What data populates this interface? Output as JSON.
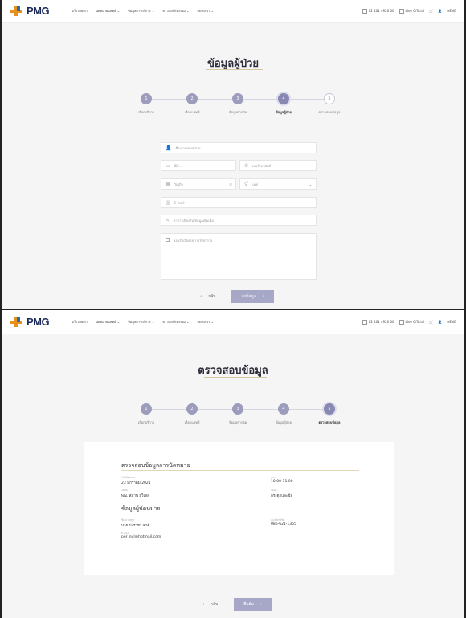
{
  "nav": {
    "logo": "PMG",
    "menu": [
      "เกี่ยวกับเรา",
      "นัดหมายแพทย์ ⌄",
      "ข้อมูลการบริการ ⌄",
      "ข่าวและกิจกรรม ⌄",
      "ติดต่อเรา ⌄"
    ],
    "phone": "02 401 4920 00",
    "line": "Line Official",
    "lang": "ENG"
  },
  "screen1": {
    "title": "ข้อมูลผู้ป่วย",
    "steps": [
      {
        "num": "1",
        "label": "เลือกบริการ",
        "state": "done"
      },
      {
        "num": "2",
        "label": "เลือกแพทย์",
        "state": "done"
      },
      {
        "num": "3",
        "label": "ข้อมูลการนัด",
        "state": "done"
      },
      {
        "num": "4",
        "label": "ข้อมูลผู้ป่วย",
        "state": "active"
      },
      {
        "num": "5",
        "label": "ตรวจสอบข้อมูล",
        "state": "pending"
      }
    ],
    "fields": {
      "name": "ชื่อ-นามสกุลผู้ป่วย",
      "id": "ID/...",
      "phone": "เบอร์โทรศัพท์",
      "birth": "วันเกิด",
      "gender": "เพศ",
      "email": "E-mail",
      "note_label": "อาการเบื้องต้น/ข้อมูลเพิ่มเติม",
      "consent": "ยอมรับเงื่อนไขการใช้บริการ"
    },
    "back": "กลับ",
    "next": "ส่งข้อมูล"
  },
  "screen2": {
    "title": "ตรวจสอบข้อมูล",
    "steps": [
      {
        "num": "1",
        "label": "เลือกบริการ",
        "state": "done"
      },
      {
        "num": "2",
        "label": "เลือกแพทย์",
        "state": "done"
      },
      {
        "num": "3",
        "label": "ข้อมูลการนัด",
        "state": "done"
      },
      {
        "num": "4",
        "label": "ข้อมูลผู้ป่วย",
        "state": "done"
      },
      {
        "num": "5",
        "label": "ตรวจสอบข้อมูล",
        "state": "active"
      }
    ],
    "section1": {
      "title": "ตรวจสอบข้อมูลการนัดหมาย",
      "date_label": "วันที่นัดหมาย",
      "date": "23 มกราคม 2021",
      "time_label": "เวลา",
      "time": "10:00-11:00",
      "doctor_label": "แพทย์",
      "doctor": "พญ. สมาน ยูวิเทล",
      "dept_label": "แผนก",
      "dept": "กระดูกและข้อ"
    },
    "section2": {
      "title": "ข้อมูลผู้นัดหมาย",
      "name_label": "ชื่อ-นามสกุล",
      "name": "นาย ปะราชา ค่าดี",
      "phone_label": "เบอร์โทรศัพท์",
      "phone": "086-621-1365",
      "email_label": "E-mail",
      "email": "por_nul@hotmail.com"
    },
    "back": "กลับ",
    "next": "ยืนยัน"
  }
}
